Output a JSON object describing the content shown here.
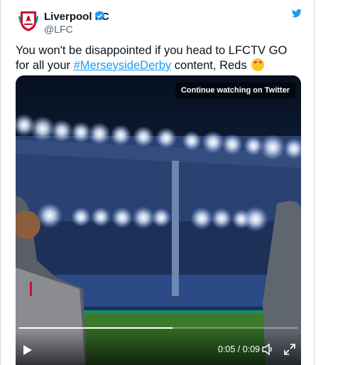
{
  "tweet": {
    "author_name": "Liverpool FC",
    "handle": "@LFC",
    "text_part1": "You won't be disappointed if you head to LFCTV GO for all your ",
    "hashtag": "#MerseysideDerby",
    "text_part2": " content, Reds",
    "emoji": "smiling-face-with-heart-eyes"
  },
  "video": {
    "continue_label": "Continue watching on Twitter",
    "time_display": "0:05 / 0:09",
    "progress": 0.55
  },
  "colors": {
    "accent": "#1d9bf0",
    "text": "#0f1419",
    "muted": "#536471",
    "border": "#cfd9de"
  },
  "icons": {
    "avatar": "liverpool-crest-icon",
    "verified": "verified-badge-icon",
    "brand": "twitter-bird-icon",
    "play": "play-icon",
    "volume": "volume-icon",
    "fullscreen": "fullscreen-icon"
  }
}
